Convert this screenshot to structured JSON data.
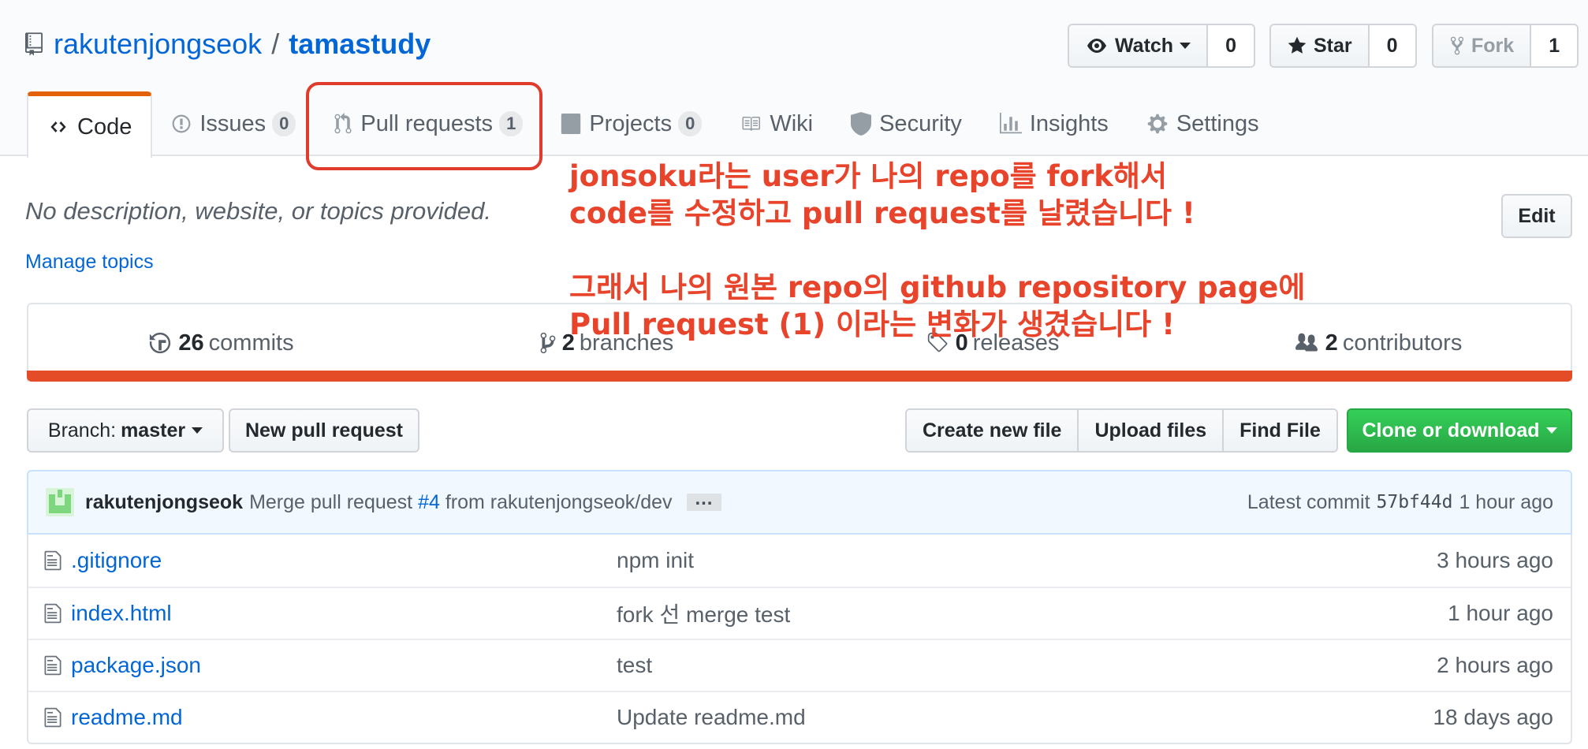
{
  "repo": {
    "owner": "rakutenjongseok",
    "separator": "/",
    "name": "tamastudy"
  },
  "actions": {
    "watch": {
      "label": "Watch",
      "count": "0"
    },
    "star": {
      "label": "Star",
      "count": "0"
    },
    "fork": {
      "label": "Fork",
      "count": "1"
    }
  },
  "tabs": [
    {
      "label": "Code"
    },
    {
      "label": "Issues",
      "count": "0"
    },
    {
      "label": "Pull requests",
      "count": "1"
    },
    {
      "label": "Projects",
      "count": "0"
    },
    {
      "label": "Wiki"
    },
    {
      "label": "Security"
    },
    {
      "label": "Insights"
    },
    {
      "label": "Settings"
    }
  ],
  "annotation": {
    "line1": "jonsoku라는 user가 나의 repo를 fork해서",
    "line2": "code를 수정하고 pull request를 날렸습니다 !",
    "line3": "그래서 나의 원본 repo의 github repository page에",
    "line4": "Pull request (1) 이라는 변화가 생겼습니다 !",
    "color": "#e8432b"
  },
  "description": "No description, website, or topics provided.",
  "manage_topics": "Manage topics",
  "edit_label": "Edit",
  "summary": {
    "commits": {
      "count": "26",
      "label": "commits"
    },
    "branches": {
      "count": "2",
      "label": "branches"
    },
    "releases": {
      "count": "0",
      "label": "releases"
    },
    "contributors": {
      "count": "2",
      "label": "contributors"
    }
  },
  "language_color": "#e34c26",
  "toolbar": {
    "branch_prefix": "Branch:",
    "branch_name": "master",
    "new_pr": "New pull request",
    "create_file": "Create new file",
    "upload_files": "Upload files",
    "find_file": "Find File",
    "clone": "Clone or download"
  },
  "commit": {
    "author": "rakutenjongseok",
    "msg_prefix": "Merge pull request",
    "pr_link": "#4",
    "msg_suffix": "from rakutenjongseok/dev",
    "ellipsis": "…",
    "latest_label": "Latest commit",
    "sha": "57bf44d",
    "age": "1 hour ago"
  },
  "files": [
    {
      "name": ".gitignore",
      "message": "npm init",
      "age": "3 hours ago"
    },
    {
      "name": "index.html",
      "message": "fork 선 merge test",
      "age": "1 hour ago"
    },
    {
      "name": "package.json",
      "message": "test",
      "age": "2 hours ago"
    },
    {
      "name": "readme.md",
      "message": "Update readme.md",
      "age": "18 days ago"
    }
  ]
}
